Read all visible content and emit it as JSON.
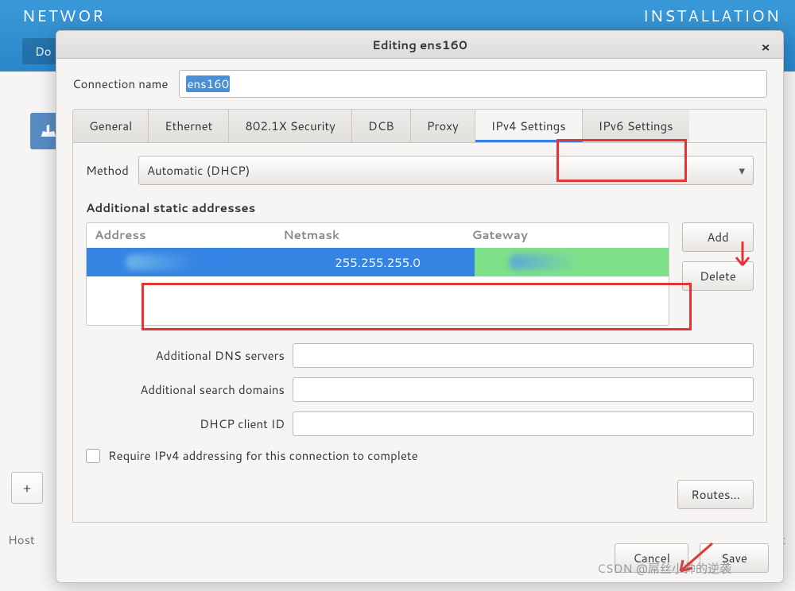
{
  "background": {
    "header_title": "NETWOR",
    "install_text": "INSTALLATION",
    "done_label": "Do",
    "host_label_left": "Host",
    "host_label_right": "calhost",
    "plus_label": "+"
  },
  "dialog": {
    "title": "Editing ens160",
    "close_icon": "×",
    "connection_name_label": "Connection name",
    "connection_name_value": "ens160",
    "tabs": [
      {
        "id": "general",
        "label": "General"
      },
      {
        "id": "ethernet",
        "label": "Ethernet"
      },
      {
        "id": "8021x",
        "label": "802.1X Security"
      },
      {
        "id": "dcb",
        "label": "DCB"
      },
      {
        "id": "proxy",
        "label": "Proxy"
      },
      {
        "id": "ipv4",
        "label": "IPv4 Settings",
        "active": true,
        "highlight": true
      },
      {
        "id": "ipv6",
        "label": "IPv6 Settings"
      }
    ],
    "method_label": "Method",
    "method_value": "Automatic (DHCP)",
    "addresses_section": "Additional static addresses",
    "addr_headers": {
      "address": "Address",
      "netmask": "Netmask",
      "gateway": "Gateway"
    },
    "addr_row": {
      "address": "",
      "netmask": "255.255.255.0",
      "gateway": ""
    },
    "buttons": {
      "add": "Add",
      "delete": "Delete",
      "routes": "Routes…",
      "cancel": "Cancel",
      "save": "Save"
    },
    "dns_label": "Additional DNS servers",
    "dns_value": "",
    "search_label": "Additional search domains",
    "search_value": "",
    "dhcp_client_label": "DHCP client ID",
    "dhcp_client_value": "",
    "require_ipv4_label": "Require IPv4 addressing for this connection to complete",
    "require_ipv4_checked": false
  },
  "watermark": "CSDN @屌丝小帅的逆袭"
}
